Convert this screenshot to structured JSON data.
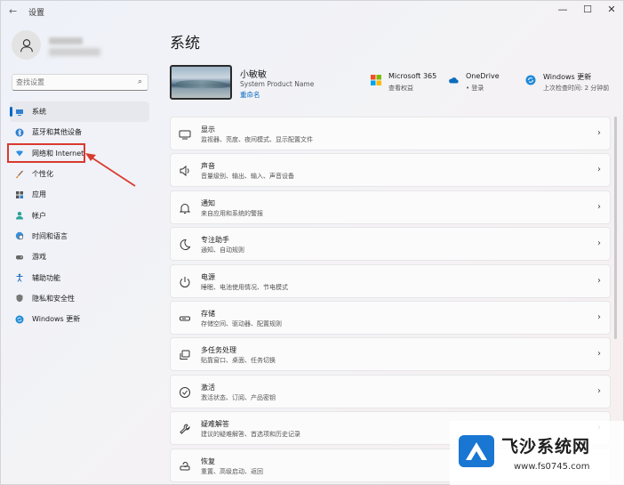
{
  "window": {
    "back": "←",
    "title": "设置",
    "minimize": "—",
    "maximize": "☐",
    "close": "✕"
  },
  "search": {
    "placeholder": "查找设置"
  },
  "sidebar": {
    "items": [
      {
        "label": "系统",
        "icon": "monitor-icon",
        "active": true
      },
      {
        "label": "蓝牙和其他设备",
        "icon": "bluetooth-icon"
      },
      {
        "label": "网络和 Internet",
        "icon": "wifi-icon"
      },
      {
        "label": "个性化",
        "icon": "brush-icon"
      },
      {
        "label": "应用",
        "icon": "apps-icon"
      },
      {
        "label": "帐户",
        "icon": "person-icon"
      },
      {
        "label": "时间和语言",
        "icon": "globe-clock-icon"
      },
      {
        "label": "游戏",
        "icon": "gamepad-icon"
      },
      {
        "label": "辅助功能",
        "icon": "accessibility-icon"
      },
      {
        "label": "隐私和安全性",
        "icon": "shield-icon"
      },
      {
        "label": "Windows 更新",
        "icon": "update-icon"
      }
    ]
  },
  "main": {
    "title": "系统",
    "device": {
      "name": "小敏敏",
      "model": "System Product Name",
      "rename": "重命名"
    },
    "status": [
      {
        "title": "Microsoft 365",
        "sub": "查看权益",
        "icon": "microsoft-logo-icon"
      },
      {
        "title": "OneDrive",
        "sub": "• 登录",
        "icon": "cloud-icon"
      },
      {
        "title": "Windows 更新",
        "sub": "上次检查时间: 2 分钟前",
        "icon": "update-icon"
      }
    ],
    "cards": [
      {
        "title": "显示",
        "sub": "监视器、亮度、夜间模式、显示配置文件",
        "icon": "display-icon"
      },
      {
        "title": "声音",
        "sub": "音量级别、输出、输入、声音设备",
        "icon": "speaker-icon"
      },
      {
        "title": "通知",
        "sub": "来自应用和系统的警报",
        "icon": "bell-icon"
      },
      {
        "title": "专注助手",
        "sub": "通知、自动规则",
        "icon": "moon-icon"
      },
      {
        "title": "电源",
        "sub": "睡眠、电池使用情况、节电模式",
        "icon": "power-icon"
      },
      {
        "title": "存储",
        "sub": "存储空间、驱动器、配置规则",
        "icon": "storage-icon"
      },
      {
        "title": "多任务处理",
        "sub": "贴靠窗口、桌面、任务切换",
        "icon": "multitask-icon"
      },
      {
        "title": "激活",
        "sub": "激活状态、订阅、产品密钥",
        "icon": "check-circle-icon"
      },
      {
        "title": "疑难解答",
        "sub": "建议的疑难解答、首选项和历史记录",
        "icon": "wrench-icon"
      },
      {
        "title": "恢复",
        "sub": "重置、高级启动、返回",
        "icon": "recovery-icon"
      }
    ],
    "chevron": "›"
  },
  "watermark": {
    "text": "飞沙系统网",
    "url": "www.fs0745.com"
  },
  "colors": {
    "accent": "#0067c0",
    "highlight": "#d93a2e"
  }
}
